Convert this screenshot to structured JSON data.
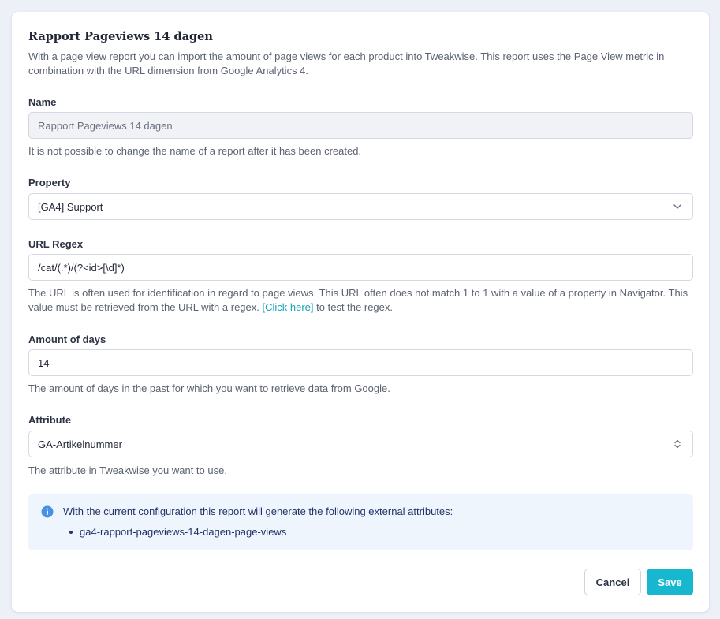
{
  "title": "Rapport Pageviews 14 dagen",
  "intro": "With a page view report you can import the amount of page views for each product into Tweakwise. This report uses the Page View metric in combination with the URL dimension from Google Analytics 4.",
  "name": {
    "label": "Name",
    "value": "Rapport Pageviews 14 dagen",
    "help": "It is not possible to change the name of a report after it has been created."
  },
  "property": {
    "label": "Property",
    "value": "[GA4] Support",
    "icon": "chevron-down-icon"
  },
  "url_regex": {
    "label": "URL Regex",
    "value": "/cat/(.*)/(?<id>[\\d]*)",
    "help_part1": "The URL is often used for identification in regard to page views. This URL often does not match 1 to 1 with a value of a property in Navigator. This value must be retrieved from the URL with a regex.",
    "help_link": "[Click here]",
    "help_part2": "to test the regex."
  },
  "days": {
    "label": "Amount of days",
    "value": "14",
    "help": "The amount of days in the past for which you want to retrieve data from Google."
  },
  "attribute": {
    "label": "Attribute",
    "value": "GA-Artikelnummer",
    "help": "The attribute in Tweakwise you want to use.",
    "icon": "sort-arrows-icon"
  },
  "info": {
    "icon": "info-icon",
    "text": "With the current configuration this report will generate the following external attributes:",
    "items": [
      "ga4-rapport-pageviews-14-dagen-page-views"
    ]
  },
  "buttons": {
    "cancel": "Cancel",
    "save": "Save"
  },
  "colors": {
    "accent": "#17b8cf",
    "link": "#17a2b8",
    "info_bg": "#eef5fd",
    "info_icon": "#4a90e2",
    "background": "#edf0f7"
  }
}
